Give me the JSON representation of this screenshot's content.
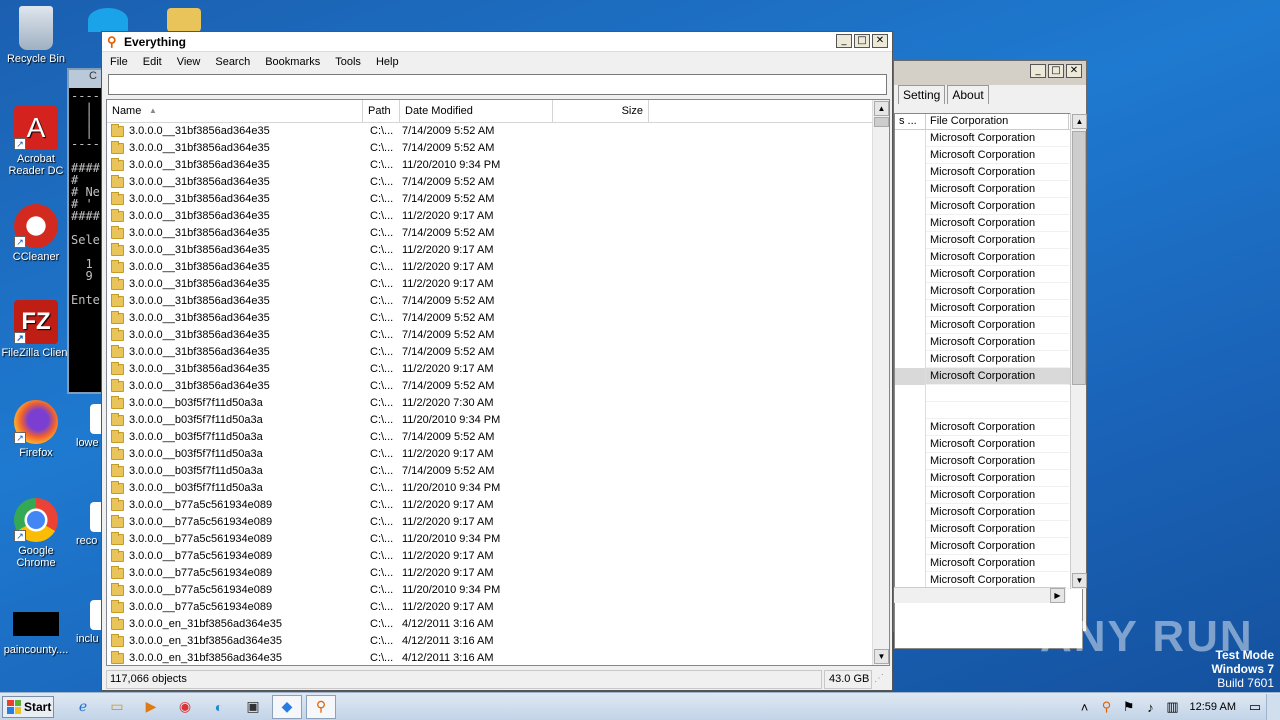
{
  "desktop": {
    "icons": [
      {
        "label": "Recycle Bin"
      },
      {
        "label": "Acrobat Reader DC"
      },
      {
        "label": "CCleaner"
      },
      {
        "label": "FileZilla Client"
      },
      {
        "label": "Firefox"
      },
      {
        "label": "Google Chrome"
      },
      {
        "label": "paincounty...."
      }
    ],
    "partial_icons": [
      {
        "label": "lowe"
      },
      {
        "label": "reco"
      },
      {
        "label": "inclu"
      }
    ],
    "watermark": "ANY RUN",
    "test_mode": {
      "line1": "Test Mode",
      "line2": "Windows 7",
      "line3": "Build 7601"
    }
  },
  "console": {
    "title": "C",
    "text": "----\n  |\n  |\n  |\n----\n\n####\n#\n# Ne\n# '\n####\n\nSele\n\n  1\n  9\n\nEnte"
  },
  "back_window": {
    "tabs": [
      "Setting",
      "About"
    ],
    "columns": [
      "s ...",
      "File Corporation"
    ],
    "rows": [
      "Microsoft Corporation",
      "Microsoft Corporation",
      "Microsoft Corporation",
      "Microsoft Corporation",
      "Microsoft Corporation",
      "Microsoft Corporation",
      "Microsoft Corporation",
      "Microsoft Corporation",
      "Microsoft Corporation",
      "Microsoft Corporation",
      "Microsoft Corporation",
      "Microsoft Corporation",
      "Microsoft Corporation",
      "Microsoft Corporation",
      "Microsoft Corporation",
      "",
      "",
      "Microsoft Corporation",
      "Microsoft Corporation",
      "Microsoft Corporation",
      "Microsoft Corporation",
      "Microsoft Corporation",
      "Microsoft Corporation",
      "Microsoft Corporation",
      "Microsoft Corporation",
      "Microsoft Corporation",
      "Microsoft Corporation"
    ],
    "selected_index": 14
  },
  "main_window": {
    "title": "Everything",
    "menu": [
      "File",
      "Edit",
      "View",
      "Search",
      "Bookmarks",
      "Tools",
      "Help"
    ],
    "search_value": "",
    "columns": {
      "name": "Name",
      "path": "Path",
      "date": "Date Modified",
      "size": "Size"
    },
    "rows": [
      {
        "name": "3.0.0.0__31bf3856ad364e35",
        "path": "C:\\...",
        "date": "7/14/2009 5:52 AM"
      },
      {
        "name": "3.0.0.0__31bf3856ad364e35",
        "path": "C:\\...",
        "date": "7/14/2009 5:52 AM"
      },
      {
        "name": "3.0.0.0__31bf3856ad364e35",
        "path": "C:\\...",
        "date": "11/20/2010 9:34 PM"
      },
      {
        "name": "3.0.0.0__31bf3856ad364e35",
        "path": "C:\\...",
        "date": "7/14/2009 5:52 AM"
      },
      {
        "name": "3.0.0.0__31bf3856ad364e35",
        "path": "C:\\...",
        "date": "7/14/2009 5:52 AM"
      },
      {
        "name": "3.0.0.0__31bf3856ad364e35",
        "path": "C:\\...",
        "date": "11/2/2020 9:17 AM"
      },
      {
        "name": "3.0.0.0__31bf3856ad364e35",
        "path": "C:\\...",
        "date": "7/14/2009 5:52 AM"
      },
      {
        "name": "3.0.0.0__31bf3856ad364e35",
        "path": "C:\\...",
        "date": "11/2/2020 9:17 AM"
      },
      {
        "name": "3.0.0.0__31bf3856ad364e35",
        "path": "C:\\...",
        "date": "11/2/2020 9:17 AM"
      },
      {
        "name": "3.0.0.0__31bf3856ad364e35",
        "path": "C:\\...",
        "date": "11/2/2020 9:17 AM"
      },
      {
        "name": "3.0.0.0__31bf3856ad364e35",
        "path": "C:\\...",
        "date": "7/14/2009 5:52 AM"
      },
      {
        "name": "3.0.0.0__31bf3856ad364e35",
        "path": "C:\\...",
        "date": "7/14/2009 5:52 AM"
      },
      {
        "name": "3.0.0.0__31bf3856ad364e35",
        "path": "C:\\...",
        "date": "7/14/2009 5:52 AM"
      },
      {
        "name": "3.0.0.0__31bf3856ad364e35",
        "path": "C:\\...",
        "date": "7/14/2009 5:52 AM"
      },
      {
        "name": "3.0.0.0__31bf3856ad364e35",
        "path": "C:\\...",
        "date": "11/2/2020 9:17 AM"
      },
      {
        "name": "3.0.0.0__31bf3856ad364e35",
        "path": "C:\\...",
        "date": "7/14/2009 5:52 AM"
      },
      {
        "name": "3.0.0.0__b03f5f7f11d50a3a",
        "path": "C:\\...",
        "date": "11/2/2020 7:30 AM"
      },
      {
        "name": "3.0.0.0__b03f5f7f11d50a3a",
        "path": "C:\\...",
        "date": "11/20/2010 9:34 PM"
      },
      {
        "name": "3.0.0.0__b03f5f7f11d50a3a",
        "path": "C:\\...",
        "date": "7/14/2009 5:52 AM"
      },
      {
        "name": "3.0.0.0__b03f5f7f11d50a3a",
        "path": "C:\\...",
        "date": "11/2/2020 9:17 AM"
      },
      {
        "name": "3.0.0.0__b03f5f7f11d50a3a",
        "path": "C:\\...",
        "date": "7/14/2009 5:52 AM"
      },
      {
        "name": "3.0.0.0__b03f5f7f11d50a3a",
        "path": "C:\\...",
        "date": "11/20/2010 9:34 PM"
      },
      {
        "name": "3.0.0.0__b77a5c561934e089",
        "path": "C:\\...",
        "date": "11/2/2020 9:17 AM"
      },
      {
        "name": "3.0.0.0__b77a5c561934e089",
        "path": "C:\\...",
        "date": "11/2/2020 9:17 AM"
      },
      {
        "name": "3.0.0.0__b77a5c561934e089",
        "path": "C:\\...",
        "date": "11/20/2010 9:34 PM"
      },
      {
        "name": "3.0.0.0__b77a5c561934e089",
        "path": "C:\\...",
        "date": "11/2/2020 9:17 AM"
      },
      {
        "name": "3.0.0.0__b77a5c561934e089",
        "path": "C:\\...",
        "date": "11/2/2020 9:17 AM"
      },
      {
        "name": "3.0.0.0__b77a5c561934e089",
        "path": "C:\\...",
        "date": "11/20/2010 9:34 PM"
      },
      {
        "name": "3.0.0.0__b77a5c561934e089",
        "path": "C:\\...",
        "date": "11/2/2020 9:17 AM"
      },
      {
        "name": "3.0.0.0_en_31bf3856ad364e35",
        "path": "C:\\...",
        "date": "4/12/2011 3:16 AM"
      },
      {
        "name": "3.0.0.0_en_31bf3856ad364e35",
        "path": "C:\\...",
        "date": "4/12/2011 3:16 AM"
      },
      {
        "name": "3.0.0.0_en_31bf3856ad364e35",
        "path": "C:\\...",
        "date": "4/12/2011 3:16 AM"
      }
    ],
    "status_objects": "117,066 objects",
    "status_size": "43.0 GB"
  },
  "taskbar": {
    "start_label": "Start",
    "clock": "12:59 AM"
  }
}
